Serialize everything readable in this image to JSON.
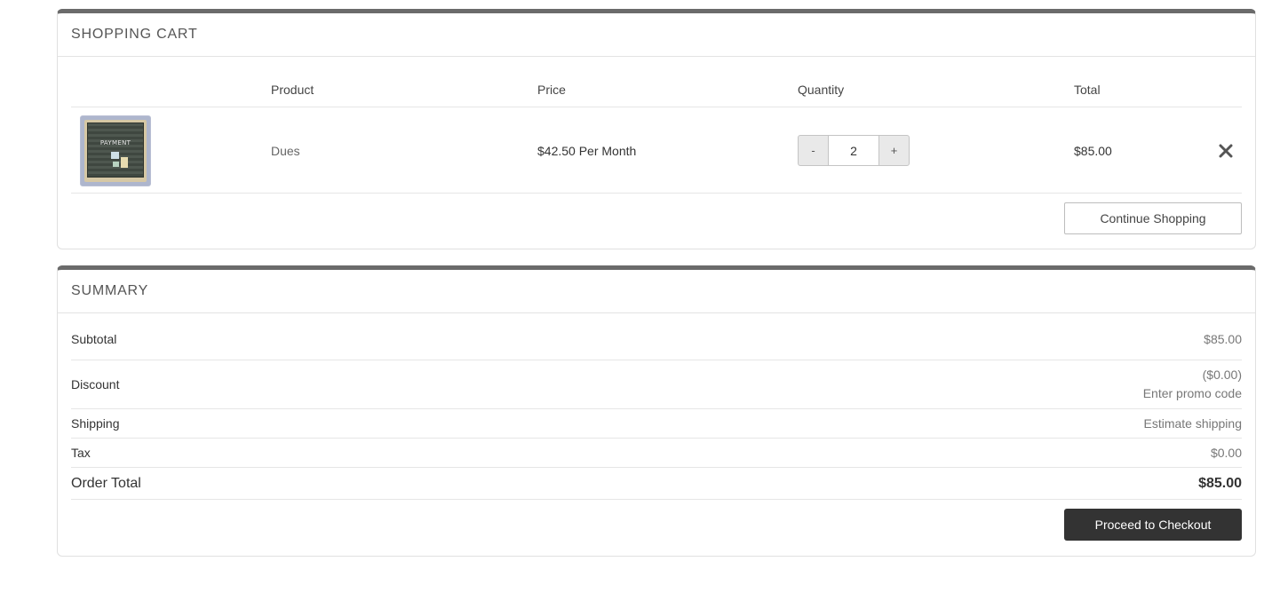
{
  "cart": {
    "title": "SHOPPING CART",
    "columns": {
      "product": "Product",
      "price": "Price",
      "quantity": "Quantity",
      "total": "Total"
    },
    "item": {
      "image_label": "PAYMENT",
      "name": "Dues",
      "price": "$42.50 Per Month",
      "quantity": "2",
      "decrement_label": "-",
      "increment_label": "+",
      "total": "$85.00",
      "remove_icon": "close-icon"
    },
    "continue_label": "Continue Shopping"
  },
  "summary": {
    "title": "SUMMARY",
    "subtotal_label": "Subtotal",
    "subtotal_value": "$85.00",
    "discount_label": "Discount",
    "discount_value": "($0.00)",
    "promo_link": "Enter promo code",
    "shipping_label": "Shipping",
    "shipping_link": "Estimate shipping",
    "tax_label": "Tax",
    "tax_value": "$0.00",
    "order_total_label": "Order Total",
    "order_total_value": "$85.00",
    "checkout_label": "Proceed to Checkout"
  },
  "colors": {
    "panel_accent": "#6b6b6b",
    "checkout_button": "#333333",
    "muted_text": "#777777"
  }
}
